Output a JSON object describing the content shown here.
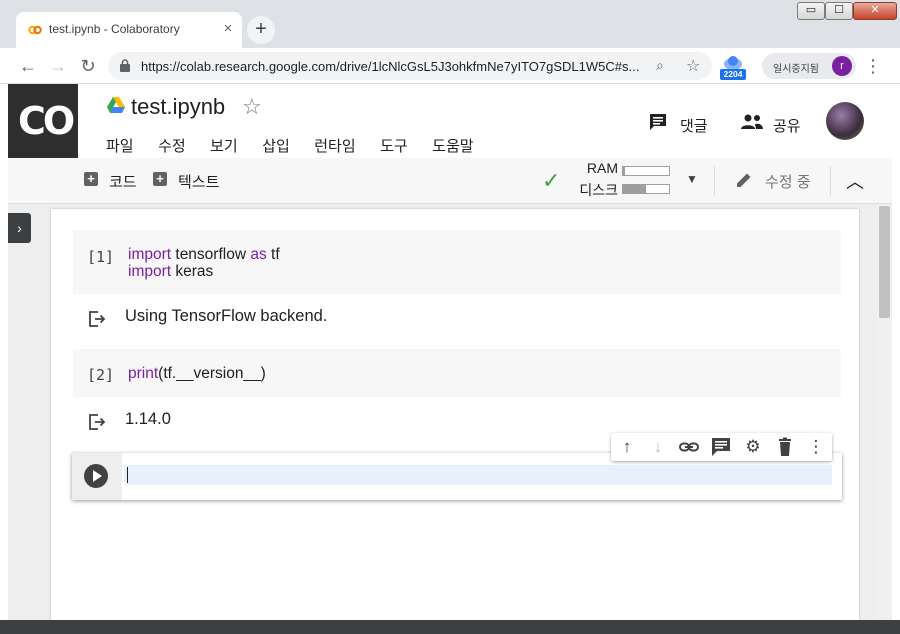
{
  "browser": {
    "tab_title": "test.ipynb - Colaboratory",
    "tab_close": "×",
    "new_tab": "+",
    "window_controls": [
      "▭",
      "☐",
      "✕"
    ],
    "url": "https://colab.research.google.com/drive/1lcNlcGsL5J3ohkfmNe7yITO7gSDL1W5C#s...",
    "extension_badge": "2204",
    "profile_label": "일시중지됨",
    "profile_initial": "r"
  },
  "colab": {
    "logo_text": "CO",
    "notebook_title": "test.ipynb",
    "star": "☆",
    "menus": [
      "파일",
      "수정",
      "보기",
      "삽입",
      "런타임",
      "도구",
      "도움말"
    ],
    "comment_label": "댓글",
    "share_label": "공유"
  },
  "toolbar": {
    "add_code": "코드",
    "add_text": "텍스트",
    "ram_label": "RAM",
    "disk_label": "디스크",
    "ram_fraction": 0.05,
    "disk_fraction": 0.5,
    "editing_label": "수정 중"
  },
  "cells": [
    {
      "exec_count": "[1]",
      "code_lines": [
        {
          "kw": "import",
          "text": " tensorflow ",
          "kw2": "as",
          "text2": " tf"
        },
        {
          "kw": "import",
          "text": " keras",
          "kw2": "",
          "text2": ""
        }
      ],
      "output": "Using TensorFlow backend."
    },
    {
      "exec_count": "[2]",
      "code_lines": [
        {
          "kw": "print",
          "text": "(tf.__version__)",
          "kw2": "",
          "text2": ""
        }
      ],
      "output": "1.14.0"
    }
  ],
  "colors": {
    "keyword": "#7b1fa2",
    "check": "#43a047",
    "logo_bg": "#2e2e2e"
  }
}
